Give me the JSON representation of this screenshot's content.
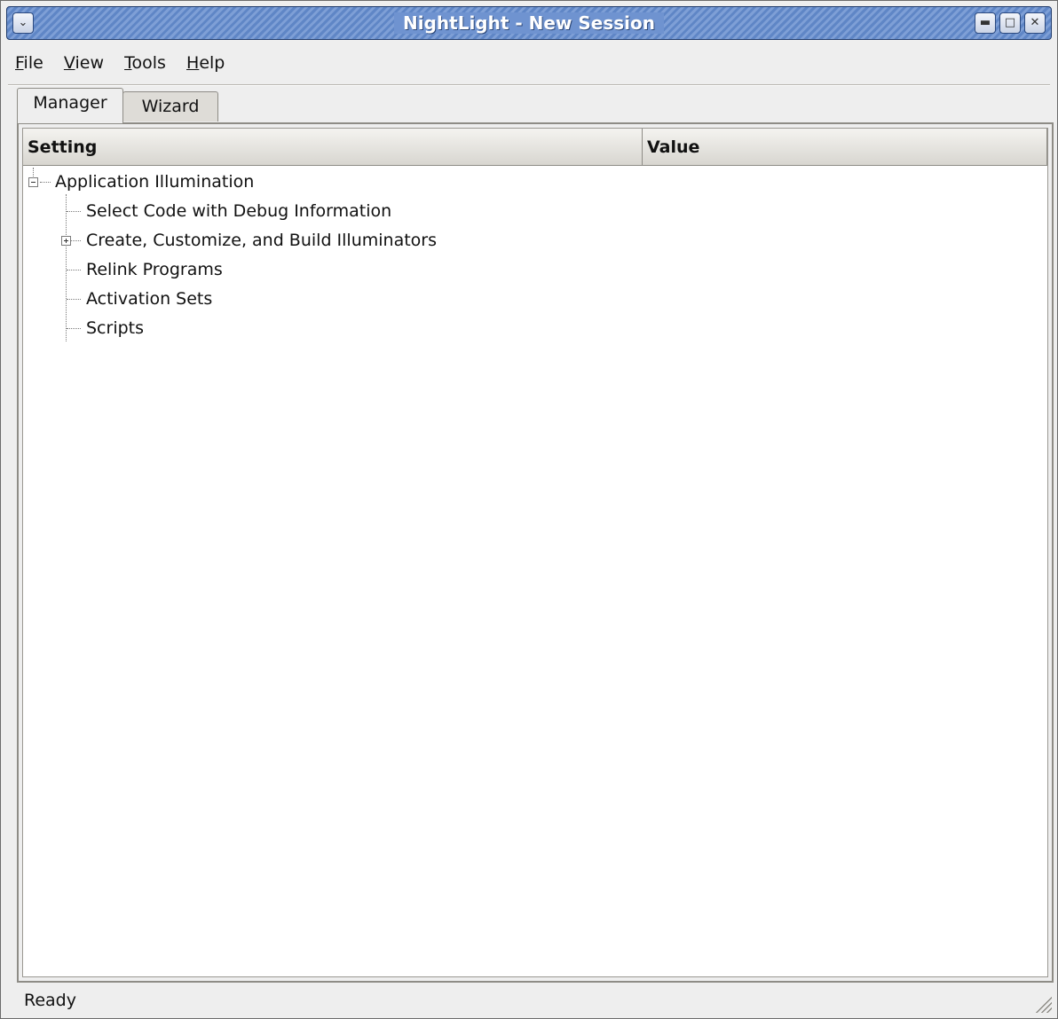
{
  "window": {
    "title": "NightLight - New Session",
    "menu_icon": "chevron-down-icon",
    "controls": {
      "minimize": "minimize-icon",
      "maximize": "maximize-icon",
      "close": "close-icon"
    }
  },
  "menubar": {
    "items": [
      {
        "label": "File",
        "mnemonic": "F",
        "rest": "ile"
      },
      {
        "label": "View",
        "mnemonic": "V",
        "rest": "iew"
      },
      {
        "label": "Tools",
        "mnemonic": "T",
        "rest": "ools"
      },
      {
        "label": "Help",
        "mnemonic": "H",
        "rest": "elp"
      }
    ]
  },
  "tabs": [
    {
      "label": "Manager",
      "active": true
    },
    {
      "label": "Wizard",
      "active": false
    }
  ],
  "table": {
    "columns": [
      "Setting",
      "Value"
    ],
    "root": {
      "label": "Application Illumination",
      "expanded": true
    },
    "children": [
      {
        "label": "Select Code with Debug Information",
        "expandable": false
      },
      {
        "label": "Create, Customize, and Build Illuminators",
        "expandable": true,
        "expanded": false
      },
      {
        "label": "Relink Programs",
        "expandable": false
      },
      {
        "label": "Activation Sets",
        "expandable": false
      },
      {
        "label": "Scripts",
        "expandable": false
      }
    ]
  },
  "status": {
    "text": "Ready"
  }
}
